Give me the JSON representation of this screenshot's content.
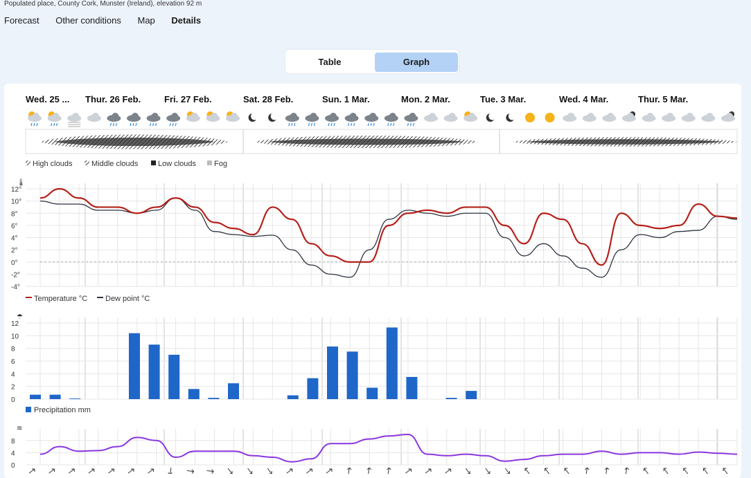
{
  "subtitle": "Populated place, County Cork, Munster (Ireland), elevation 92 m",
  "nav": [
    "Forecast",
    "Other conditions",
    "Map",
    "Details"
  ],
  "toggle": {
    "table": "Table",
    "graph": "Graph"
  },
  "days": [
    "Wed. 25 ...",
    "Thur. 26 Feb.",
    "Fri. 27 Feb.",
    "Sat. 28 Feb.",
    "Sun. 1 Mar.",
    "Mon. 2 Mar.",
    "Tue. 3 Mar.",
    "Wed. 4 Mar.",
    "Thur. 5 Mar."
  ],
  "cloud_legend": [
    "High clouds",
    "Middle clouds",
    "Low clouds",
    "Fog"
  ],
  "temp_legend": {
    "temp": "Temperature °C",
    "dew": "Dew point °C"
  },
  "precip_legend": "Precipitation mm",
  "colors": {
    "temp": "#b5201a",
    "dew": "#2c3240",
    "precip": "#1f66c9",
    "wind": "#8a36e0",
    "sub_zero": "#2f86d8"
  },
  "chart_data": [
    {
      "type": "line",
      "x": [
        0,
        1,
        2,
        3,
        4,
        5,
        6,
        7,
        8,
        9,
        10,
        11,
        12,
        13,
        14,
        15,
        16,
        17,
        18,
        19,
        20,
        21,
        22,
        23,
        24,
        25,
        26,
        27,
        28,
        29,
        30,
        31,
        32,
        33,
        34,
        35,
        36
      ],
      "series": [
        {
          "name": "Temperature °C",
          "values": [
            10.5,
            12,
            10.5,
            9,
            9,
            8,
            9,
            10.5,
            9,
            6.5,
            5.5,
            4.5,
            9,
            7,
            3,
            1,
            0,
            0,
            6,
            8,
            8.5,
            8,
            9,
            9,
            6,
            3,
            8,
            7,
            3,
            -0.5,
            8,
            6,
            5.5,
            6,
            9.5,
            7.5,
            7.2
          ]
        },
        {
          "name": "Dew point °C",
          "values": [
            10,
            9.5,
            9.5,
            8.5,
            8.5,
            8,
            8.5,
            10.5,
            8.5,
            5,
            4.5,
            4.2,
            4.4,
            2,
            -0.5,
            -2,
            -2.5,
            2,
            7,
            8.5,
            8,
            7.5,
            8,
            8,
            4,
            1,
            3,
            1,
            -1,
            -2.5,
            2,
            4.5,
            4,
            5,
            5.2,
            7.5,
            7
          ]
        }
      ],
      "ylabel": "°C",
      "ylim": [
        -4,
        12
      ],
      "yticks": [
        "12°",
        "10°",
        "8°",
        "6°",
        "4°",
        "2°",
        "0°",
        "-2°",
        "-4°"
      ],
      "grid": true
    },
    {
      "type": "bar",
      "categories": [
        0,
        1,
        2,
        3,
        4,
        5,
        6,
        7,
        8,
        9,
        10,
        11,
        12,
        13,
        14,
        15,
        16,
        17,
        18,
        19,
        20,
        21,
        22,
        23,
        24,
        25,
        26,
        27,
        28,
        29,
        30,
        31,
        32,
        33,
        34,
        35,
        36
      ],
      "values": [
        0.7,
        0.7,
        0.1,
        0,
        0,
        10.4,
        8.6,
        7,
        1.6,
        0.2,
        2.5,
        0,
        0,
        0.6,
        3.3,
        8.3,
        7.5,
        1.8,
        11.3,
        3.5,
        0,
        0.2,
        1.3,
        0,
        0,
        0,
        0,
        0,
        0,
        0,
        0,
        0,
        0,
        0,
        0,
        0,
        0
      ],
      "ylim": [
        0,
        12
      ],
      "yticks": [
        "12",
        "10",
        "8",
        "6",
        "4",
        "2",
        "0"
      ],
      "grid": true
    },
    {
      "type": "line",
      "x": [
        0,
        1,
        2,
        3,
        4,
        5,
        6,
        7,
        8,
        9,
        10,
        11,
        12,
        13,
        14,
        15,
        16,
        17,
        18,
        19,
        20,
        21,
        22,
        23,
        24,
        25,
        26,
        27,
        28,
        29,
        30,
        31,
        32,
        33,
        34,
        35,
        36
      ],
      "series": [
        {
          "name": "Wind",
          "values": [
            3.5,
            6,
            4.5,
            4.7,
            6,
            9,
            8,
            2.5,
            4.5,
            4.5,
            4.5,
            3,
            2.5,
            1,
            2,
            7,
            7,
            8.5,
            9.5,
            10,
            3.5,
            3,
            3.5,
            3,
            1.2,
            1.8,
            3,
            3.5,
            3.5,
            4.5,
            3.5,
            4,
            4,
            3.5,
            4.2,
            3.8,
            3.5
          ]
        }
      ],
      "ylim": [
        0,
        10
      ],
      "yticks": [
        "8",
        "4",
        "0"
      ],
      "grid": true
    }
  ]
}
